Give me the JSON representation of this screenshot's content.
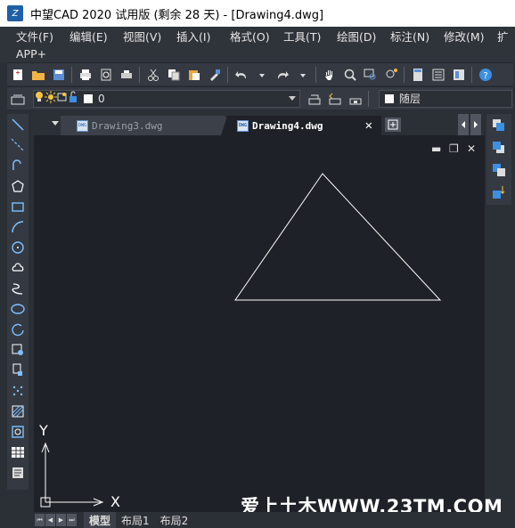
{
  "window": {
    "title": "中望CAD 2020 试用版 (剩余 28 天) - [Drawing4.dwg]",
    "logo_text": "Z"
  },
  "menu": {
    "row1": [
      "文件(F)",
      "编辑(E)",
      "视图(V)",
      "插入(I)",
      "格式(O)",
      "工具(T)",
      "绘图(D)",
      "标注(N)",
      "修改(M)",
      "扩"
    ],
    "row2": [
      "APP+"
    ]
  },
  "layer_toolbar": {
    "current_layer": "0",
    "color_value": "随层"
  },
  "tabs": [
    {
      "label": "Drawing3.dwg",
      "active": false,
      "icon": "dwg-file-icon"
    },
    {
      "label": "Drawing4.dwg",
      "active": true,
      "icon": "dwg-file-icon"
    }
  ],
  "drawing": {
    "window_controls": [
      "minimize-icon",
      "restore-icon",
      "close-icon"
    ],
    "ucs_x_label": "X",
    "ucs_y_label": "Y"
  },
  "layout_tabs": [
    "模型",
    "布局1",
    "布局2"
  ],
  "watermark": "爱上土木WWW.23TM.COM",
  "colors": {
    "background": "#1e2127",
    "panel": "#353a42",
    "line": "#ffffff",
    "accent": "#1f5fa8"
  }
}
